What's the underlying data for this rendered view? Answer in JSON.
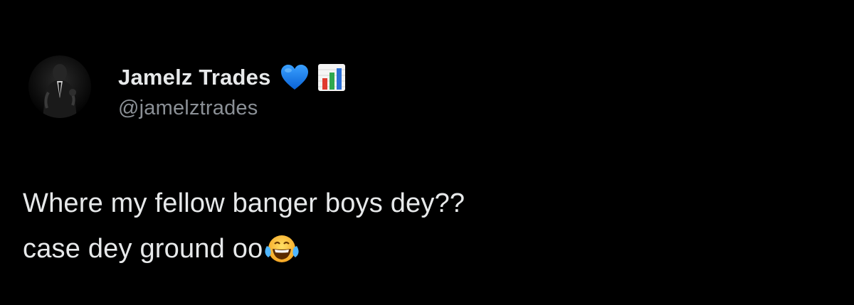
{
  "tweet": {
    "author": {
      "display_name": "Jamelz Trades",
      "handle": "@jamelztrades",
      "avatar_icon": "avatar-suited-man",
      "badges": [
        "blue-heart-icon",
        "bar-chart-icon"
      ]
    },
    "text_lines": [
      "Where my fellow banger boys dey??",
      "case dey ground oo"
    ],
    "trailing_emoji": "tears-of-joy-icon"
  },
  "colors": {
    "background": "#000000",
    "primary_text": "#e7e9ea",
    "secondary_text": "#8b9096",
    "heart_blue": "#1d8cf8"
  }
}
